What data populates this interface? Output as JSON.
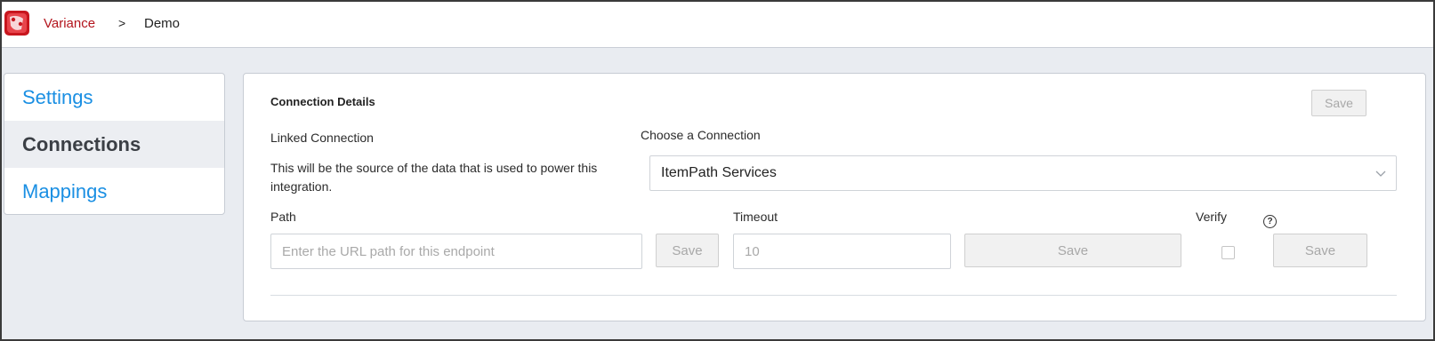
{
  "breadcrumb": {
    "root": "Variance",
    "separator": ">",
    "current": "Demo"
  },
  "sidebar": {
    "items": [
      {
        "label": "Settings",
        "active": false
      },
      {
        "label": "Connections",
        "active": true
      },
      {
        "label": "Mappings",
        "active": false
      }
    ]
  },
  "panel": {
    "title": "Connection Details",
    "top_save_label": "Save",
    "linked_connection": {
      "label": "Linked Connection",
      "description": "This will be the source of the data that is used to power this integration."
    },
    "choose_connection": {
      "label": "Choose a Connection",
      "selected": "ItemPath Services",
      "icon": "chevron-down-icon"
    },
    "path": {
      "label": "Path",
      "placeholder": "Enter the URL path for this endpoint",
      "value": "",
      "save_label": "Save"
    },
    "timeout": {
      "label": "Timeout",
      "value": "10",
      "save_label": "Save"
    },
    "verify": {
      "label": "Verify",
      "help_icon": "question-circle-icon",
      "checked": false,
      "save_label": "Save"
    }
  },
  "colors": {
    "brand_red": "#b3141c",
    "link_blue": "#1a8fe3",
    "page_bg": "#e9ecf1"
  }
}
